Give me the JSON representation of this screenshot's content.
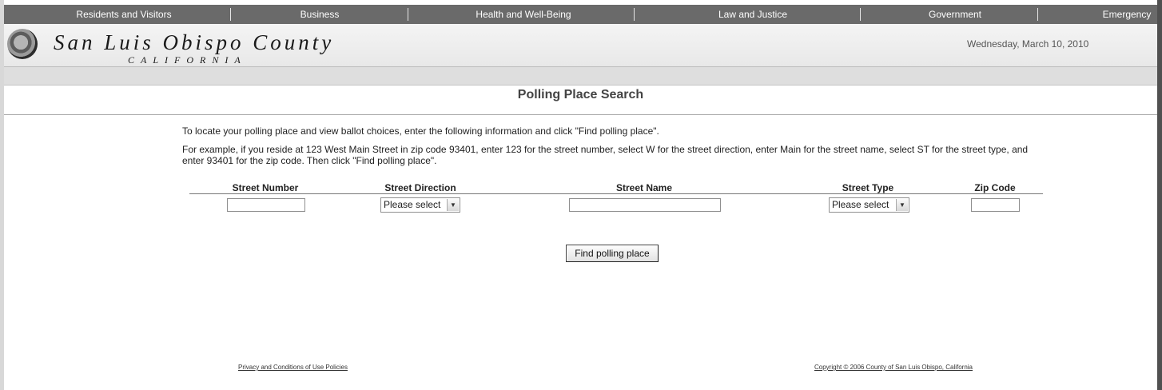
{
  "nav": {
    "items": [
      "Residents and Visitors",
      "Business",
      "Health and Well-Being",
      "Law and Justice",
      "Government",
      "Emergency"
    ]
  },
  "header": {
    "county_name": "San Luis Obispo County",
    "state": "CALIFORNIA",
    "date": "Wednesday, March 10, 2010"
  },
  "page": {
    "title": "Polling Place Search",
    "instruction_1": "To locate your polling place and view ballot choices, enter the following information and click \"Find polling place\".",
    "instruction_2": "For example, if you reside at 123 West Main Street in zip code 93401, enter 123 for the street number, select W for the street direction, enter Main for the street name, select ST for the street type, and enter 93401 for the zip code. Then click \"Find polling place\"."
  },
  "form": {
    "columns": [
      "Street Number",
      "Street Direction",
      "Street Name",
      "Street Type",
      "Zip Code"
    ],
    "street_number_value": "",
    "street_direction_selected": "Please select",
    "street_name_value": "",
    "street_type_selected": "Please select",
    "zip_code_value": "",
    "submit_label": "Find polling place"
  },
  "footer": {
    "privacy_link": "Privacy and Conditions of Use Policies",
    "copyright_link": "Copyright © 2006 County of San Luis Obispo, California"
  },
  "icons": {
    "seal": "county-seal-icon",
    "dropdown": "chevron-down-icon"
  }
}
